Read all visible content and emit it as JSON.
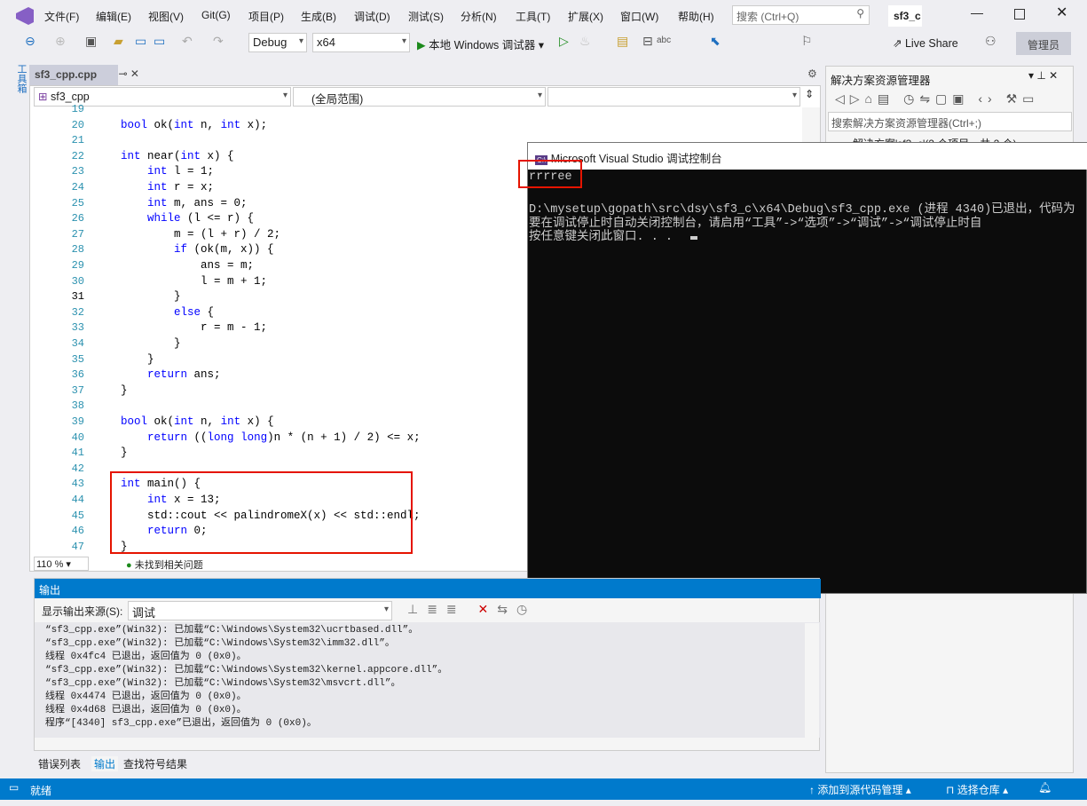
{
  "menu": {
    "items": [
      "文件(F)",
      "编辑(E)",
      "视图(V)",
      "Git(G)",
      "项目(P)",
      "生成(B)",
      "调试(D)",
      "测试(S)",
      "分析(N)",
      "工具(T)",
      "扩展(X)",
      "窗口(W)",
      "帮助(H)"
    ],
    "search_placeholder": "搜索 (Ctrl+Q)",
    "solution_name": "sf3_c"
  },
  "toolbar": {
    "config": "Debug",
    "platform": "x64",
    "run_label": "本地 Windows 调试器",
    "live_share": "Live Share",
    "admin": "管理员"
  },
  "left_rail": {
    "label": "工具箱"
  },
  "editor": {
    "tab": "sf3_cpp.cpp",
    "nav_project": "sf3_cpp",
    "nav_scope": "(全局范围)",
    "nav_member": "",
    "zoom": "110 %",
    "issues": "未找到相关问题",
    "lines": [
      {
        "n": "19",
        "t": ""
      },
      {
        "n": "20",
        "t": "bool ok(int n, int x);"
      },
      {
        "n": "21",
        "t": ""
      },
      {
        "n": "22",
        "t": "int near(int x) {"
      },
      {
        "n": "23",
        "t": "    int l = 1;"
      },
      {
        "n": "24",
        "t": "    int r = x;"
      },
      {
        "n": "25",
        "t": "    int m, ans = 0;"
      },
      {
        "n": "26",
        "t": "    while (l <= r) {"
      },
      {
        "n": "27",
        "t": "        m = (l + r) / 2;"
      },
      {
        "n": "28",
        "t": "        if (ok(m, x)) {"
      },
      {
        "n": "29",
        "t": "            ans = m;"
      },
      {
        "n": "30",
        "t": "            l = m + 1;"
      },
      {
        "n": "31",
        "t": "        }"
      },
      {
        "n": "32",
        "t": "        else {"
      },
      {
        "n": "33",
        "t": "            r = m - 1;"
      },
      {
        "n": "34",
        "t": "        }"
      },
      {
        "n": "35",
        "t": "    }"
      },
      {
        "n": "36",
        "t": "    return ans;"
      },
      {
        "n": "37",
        "t": "}"
      },
      {
        "n": "38",
        "t": ""
      },
      {
        "n": "39",
        "t": "bool ok(int n, int x) {"
      },
      {
        "n": "40",
        "t": "    return ((long long)n * (n + 1) / 2) <= x;"
      },
      {
        "n": "41",
        "t": "}"
      },
      {
        "n": "42",
        "t": ""
      },
      {
        "n": "43",
        "t": "int main() {"
      },
      {
        "n": "44",
        "t": "    int x = 13;"
      },
      {
        "n": "45",
        "t": "    std::cout << palindromeX(x) << std::endl;"
      },
      {
        "n": "46",
        "t": "    return 0;"
      },
      {
        "n": "47",
        "t": "}"
      }
    ]
  },
  "console": {
    "title": "Microsoft Visual Studio 调试控制台",
    "lines": [
      "rrrree",
      "",
      "D:\\mysetup\\gopath\\src\\dsy\\sf3_c\\x64\\Debug\\sf3_cpp.exe (进程 4340)已退出，代码为",
      "要在调试停止时自动关闭控制台，请启用“工具”->“选项”->“调试”->“调试停止时自",
      "按任意键关闭此窗口. . ."
    ]
  },
  "solution_explorer": {
    "title": "解决方案资源管理器",
    "search_placeholder": "搜索解决方案资源管理器(Ctrl+;)",
    "root": "解决方案'sf3_c'(2 个项目，共 2 个)"
  },
  "output": {
    "title": "输出",
    "source_label": "显示输出来源(S):",
    "source": "调试",
    "lines": [
      "“sf3_cpp.exe”(Win32): 已加载“C:\\Windows\\System32\\ucrtbased.dll”。",
      "“sf3_cpp.exe”(Win32): 已加载“C:\\Windows\\System32\\imm32.dll”。",
      "线程 0x4fc4 已退出，返回值为 0 (0x0)。",
      "“sf3_cpp.exe”(Win32): 已加载“C:\\Windows\\System32\\kernel.appcore.dll”。",
      "“sf3_cpp.exe”(Win32): 已加载“C:\\Windows\\System32\\msvcrt.dll”。",
      "线程 0x4474 已退出，返回值为 0 (0x0)。",
      "线程 0x4d68 已退出，返回值为 0 (0x0)。",
      "程序“[4340] sf3_cpp.exe”已退出，返回值为 0 (0x0)。"
    ]
  },
  "bottom_tabs": [
    "错误列表",
    "输出",
    "查找符号结果"
  ],
  "status": {
    "text": "就绪",
    "source_control": "添加到源代码管理",
    "repo": "选择仓库"
  },
  "colors": {
    "accent": "#007acc",
    "highlight_box": "#e51400",
    "console_bg": "#0c0c0c"
  }
}
